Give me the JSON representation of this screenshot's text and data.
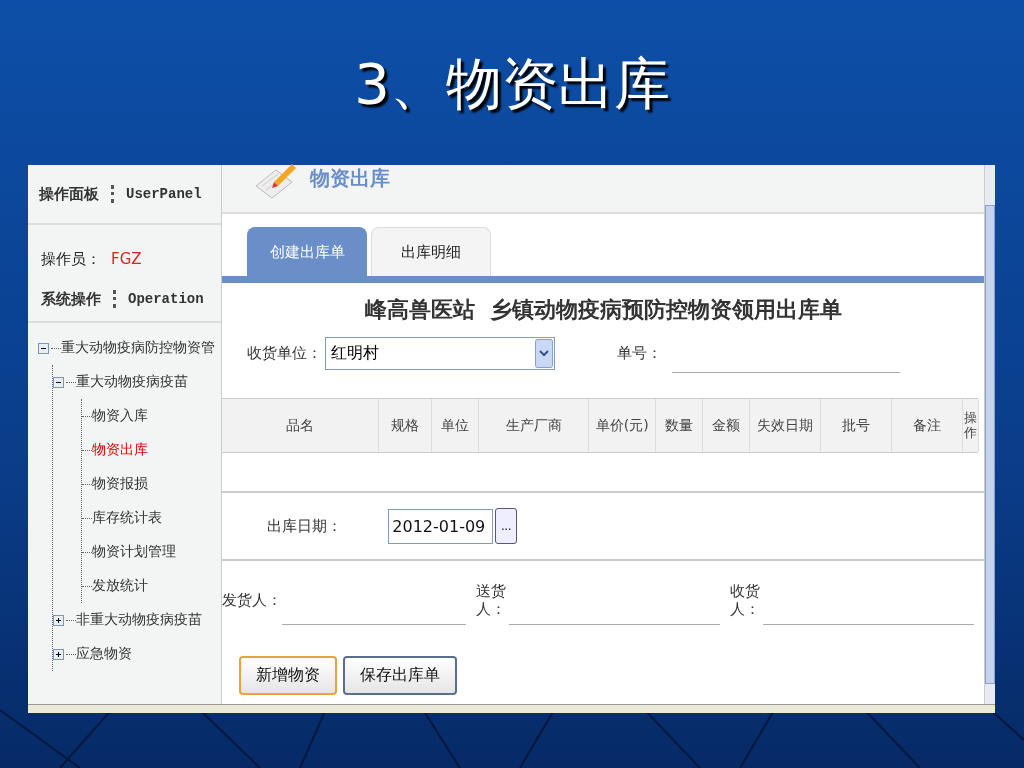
{
  "slide": {
    "title": "3、物资出库"
  },
  "sidebar": {
    "panel_title": "操作面板",
    "panel_title_en": "UserPanel",
    "operator_label": "操作员：",
    "operator": "FGZ",
    "operation_title": "系统操作",
    "operation_title_en": "Operation",
    "tree": [
      {
        "label": "重大动物疫病防控物资管",
        "expanded": true,
        "children": [
          {
            "label": "重大动物疫病疫苗",
            "expanded": true,
            "children": [
              {
                "label": "物资入库",
                "selected": false
              },
              {
                "label": "物资出库",
                "selected": true
              },
              {
                "label": "物资报损",
                "selected": false
              },
              {
                "label": "库存统计表",
                "selected": false
              },
              {
                "label": "物资计划管理",
                "selected": false
              },
              {
                "label": "发放统计",
                "selected": false
              }
            ]
          },
          {
            "label": "非重大动物疫病疫苗",
            "expanded": false
          },
          {
            "label": "应急物资",
            "expanded": false
          }
        ]
      }
    ]
  },
  "page": {
    "title": "物资出库"
  },
  "tabs": [
    {
      "label": "创建出库单",
      "selected": true
    },
    {
      "label": "出库明细",
      "selected": false
    }
  ],
  "form": {
    "title": "峰高兽医站  乡镇动物疫病预防控物资领用出库单",
    "receiver_unit_label": "收货单位：",
    "receiver_unit": "红明村",
    "number_label": "单号：",
    "date_label": "出库日期：",
    "date": "2012-01-09",
    "date_button": "...",
    "persons": [
      {
        "label": "发货人："
      },
      {
        "label": "送货人："
      },
      {
        "label": "收货人："
      }
    ]
  },
  "table": {
    "columns": [
      "品名",
      "规格",
      "单位",
      "生产厂商",
      "单价(元)",
      "数量",
      "金额",
      "失效日期",
      "批号",
      "备注",
      "操作"
    ]
  },
  "buttons": [
    {
      "label": "新增物资",
      "focused": true
    },
    {
      "label": "保存出库单",
      "focused": false
    }
  ]
}
